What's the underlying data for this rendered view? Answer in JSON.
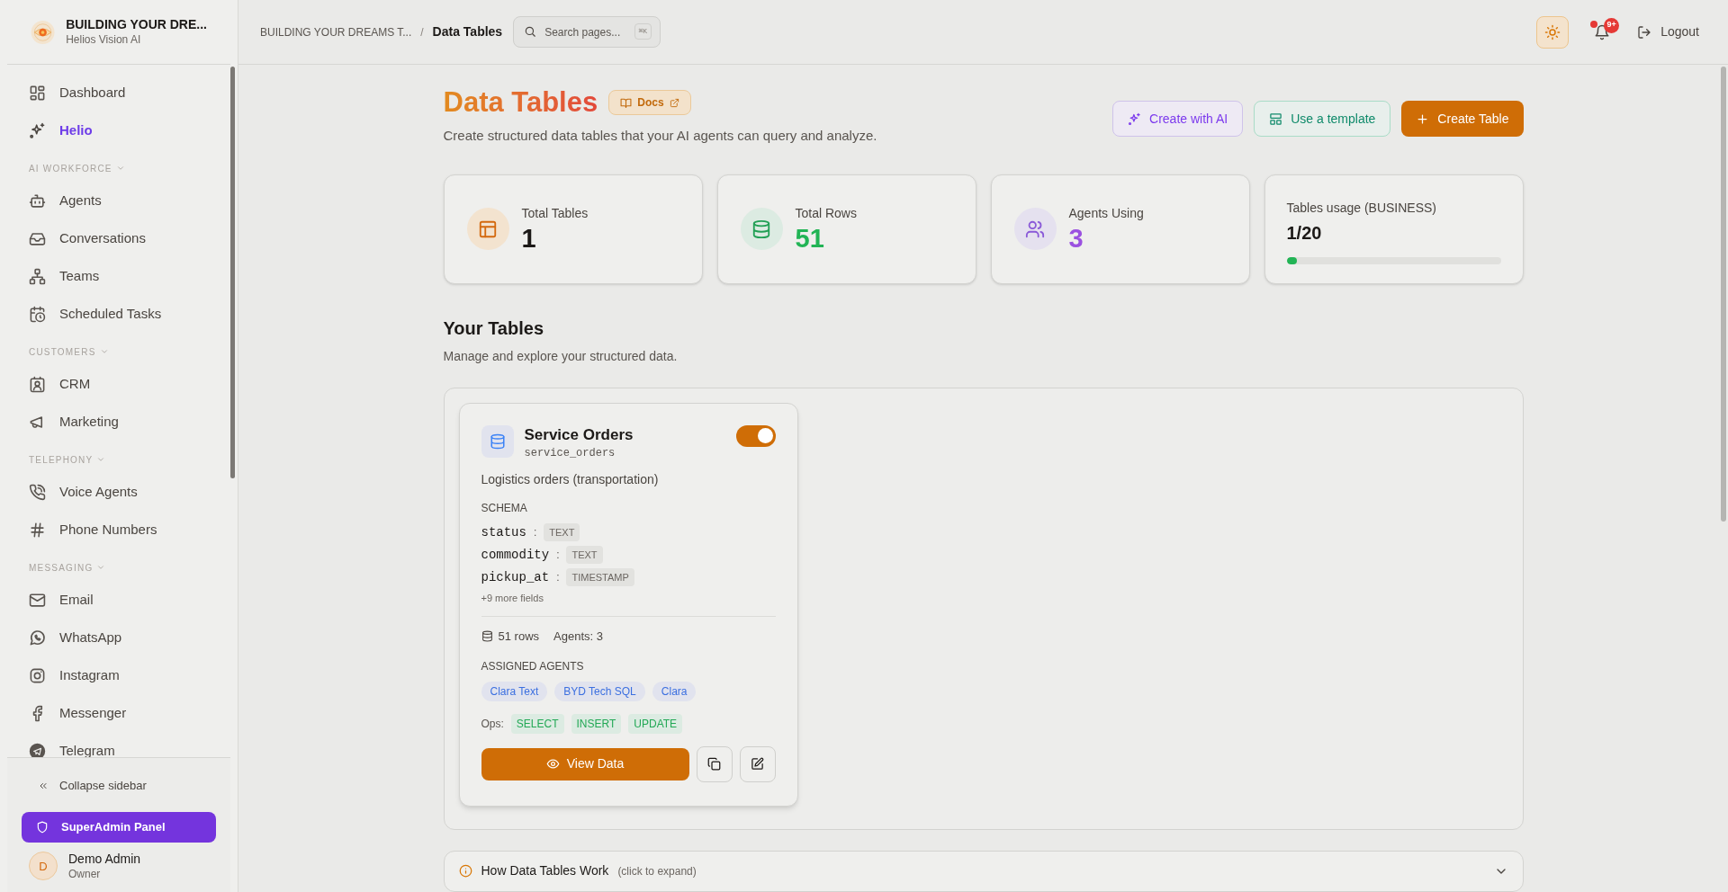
{
  "sidebar": {
    "org_name": "BUILDING YOUR DRE...",
    "org_subtitle": "Helios Vision AI",
    "groups": [
      {
        "items": [
          {
            "label": "Dashboard",
            "selected": false
          },
          {
            "label": "Helio",
            "selected": true
          }
        ]
      },
      {
        "heading": "AI WORKFORCE",
        "items": [
          {
            "label": "Agents",
            "selected": false
          },
          {
            "label": "Conversations",
            "selected": false
          },
          {
            "label": "Teams",
            "selected": false
          },
          {
            "label": "Scheduled Tasks",
            "selected": false
          }
        ]
      },
      {
        "heading": "CUSTOMERS",
        "items": [
          {
            "label": "CRM",
            "selected": false
          },
          {
            "label": "Marketing",
            "selected": false
          }
        ]
      },
      {
        "heading": "TELEPHONY",
        "items": [
          {
            "label": "Voice Agents",
            "selected": false
          },
          {
            "label": "Phone Numbers",
            "selected": false
          }
        ]
      },
      {
        "heading": "MESSAGING",
        "items": [
          {
            "label": "Email",
            "selected": false
          },
          {
            "label": "WhatsApp",
            "selected": false
          },
          {
            "label": "Instagram",
            "selected": false
          },
          {
            "label": "Messenger",
            "selected": false
          },
          {
            "label": "Telegram",
            "selected": false
          }
        ]
      }
    ],
    "collapse_label": "Collapse sidebar",
    "admin_button": "SuperAdmin Panel",
    "user": {
      "initial": "D",
      "name": "Demo Admin",
      "role": "Owner"
    }
  },
  "header": {
    "breadcrumb": [
      "BUILDING YOUR DREAMS T...",
      "Data Tables"
    ],
    "breadcrumb_separator": "/",
    "search": {
      "placeholder": "Search pages...",
      "shortcut": "⌘K"
    },
    "notification_count": "9+",
    "logout": "Logout"
  },
  "page": {
    "title": "Data Tables",
    "docs_label": "Docs",
    "subtitle": "Create structured data tables that your AI agents can query and analyze.",
    "actions": [
      {
        "label": "Create with AI",
        "kind": "ai"
      },
      {
        "label": "Use a template",
        "kind": "template"
      },
      {
        "label": "Create Table",
        "kind": "primary"
      }
    ]
  },
  "stats": [
    {
      "label": "Total Tables",
      "value": "1",
      "kind": "count",
      "color": "#1c1917"
    },
    {
      "label": "Total Rows",
      "value": "51",
      "kind": "count",
      "color": "#22b455"
    },
    {
      "label": "Agents Using",
      "value": "3",
      "kind": "count",
      "color": "#9b51e0"
    },
    {
      "label": "Tables usage (BUSINESS)",
      "value": "1/20",
      "kind": "usage",
      "level": 0.05
    }
  ],
  "section": {
    "title": "Your Tables",
    "subtitle": "Manage and explore your structured data."
  },
  "tables": [
    {
      "name": "Service Orders",
      "slug": "service_orders",
      "enabled": true,
      "description": "Logistics orders (transportation)",
      "schema_label": "SCHEMA",
      "field_separator": ":",
      "fields": [
        {
          "name": "status",
          "type": "TEXT"
        },
        {
          "name": "commodity",
          "type": "TEXT"
        },
        {
          "name": "pickup_at",
          "type": "TIMESTAMP"
        }
      ],
      "more_fields": "+9 more fields",
      "rows": "51 rows",
      "agents_count": "Agents: 3",
      "agents_label": "ASSIGNED AGENTS",
      "agents": [
        "Clara Text",
        "BYD Tech SQL",
        "Clara"
      ],
      "ops_label": "Ops:",
      "ops": [
        "SELECT",
        "INSERT",
        "UPDATE"
      ],
      "view_button": "View Data"
    }
  ],
  "info": {
    "title": "How Data Tables Work",
    "hint": "(click to expand)",
    "expanded": false
  }
}
